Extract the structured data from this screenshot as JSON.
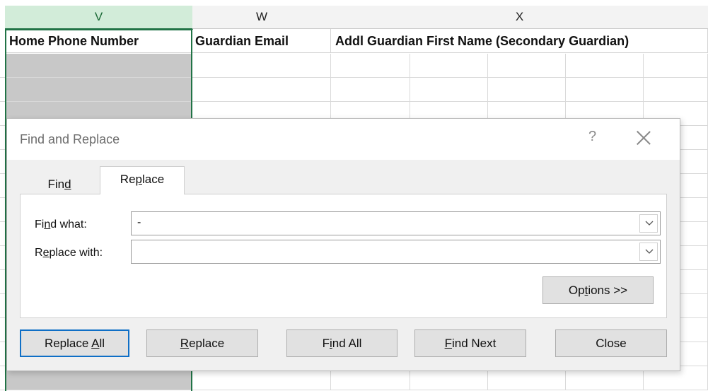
{
  "sheet": {
    "columns": [
      {
        "letter": "V",
        "selected": true
      },
      {
        "letter": "W",
        "selected": false
      },
      {
        "letter": "X",
        "selected": false
      }
    ],
    "headers": [
      "Home Phone Number",
      "Guardian Email",
      "Addl Guardian First Name (Secondary Guardian)"
    ],
    "selected_fill": "#c8c8c8",
    "selection_color": "#217346"
  },
  "dialog": {
    "title": "Find and Replace",
    "help_glyph": "?",
    "close_icon": "close-icon",
    "tabs": {
      "find": {
        "pre": "Fin",
        "ul": "d",
        "post": ""
      },
      "replace": {
        "pre": "Re",
        "ul": "p",
        "post": "lace"
      }
    },
    "active_tab": "Replace",
    "find_what": {
      "pre": "Fi",
      "ul": "n",
      "post": "d what:",
      "value": "-"
    },
    "replace_with": {
      "pre": "R",
      "ul": "e",
      "post": "place with:",
      "value": ""
    },
    "buttons": {
      "options": {
        "pre": "Op",
        "ul": "t",
        "post": "ions >>"
      },
      "replace_all": {
        "pre": "Replace ",
        "ul": "A",
        "post": "ll"
      },
      "replace": {
        "pre": "",
        "ul": "R",
        "post": "eplace"
      },
      "find_all": {
        "pre": "F",
        "ul": "i",
        "post": "nd All"
      },
      "find_next": {
        "pre": "",
        "ul": "F",
        "post": "ind Next"
      },
      "close": {
        "pre": "Close",
        "ul": "",
        "post": ""
      }
    },
    "default_button_color": "#0f6fc6"
  }
}
